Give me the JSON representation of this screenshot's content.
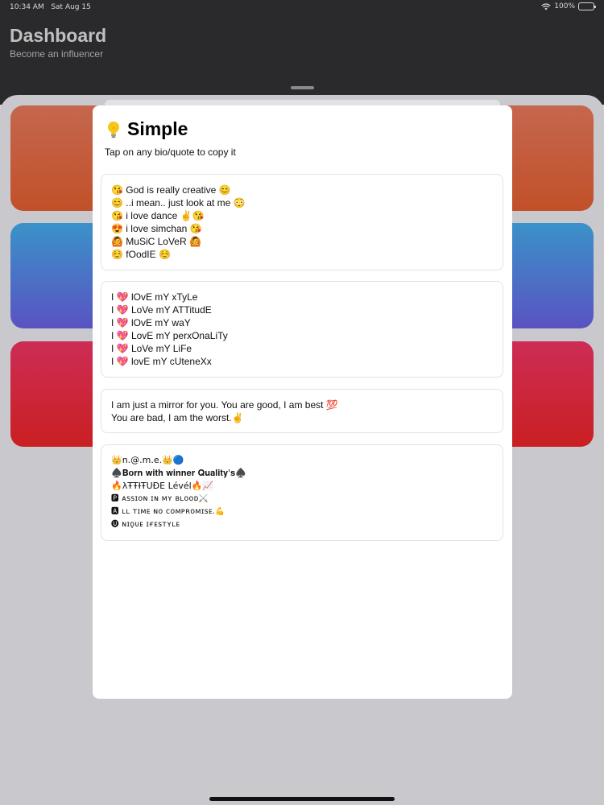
{
  "status": {
    "time": "10:34 AM",
    "date": "Sat Aug 15",
    "battery": "100%"
  },
  "dashboard": {
    "title": "Dashboard",
    "subtitle": "Become an influencer"
  },
  "modal": {
    "title": "Simple",
    "hint": "Tap on any bio/quote to copy it",
    "bios": [
      {
        "lines": [
          "😘 God is really creative 😊",
          "😊 ..i mean.. just look at me 😳",
          "😘 i love dance ✌️😘",
          "😍 i love simchan 😘",
          "🙆 MuSiC LoVeR 🙆",
          "☺️ fOodIE ☺️"
        ]
      },
      {
        "lines": [
          "I 💖 lOvE mY xTyLe",
          "I 💖 LoVe mY ATTitudE",
          "I 💖 lOvE mY waY",
          "I 💖 LovE mY perxOnaLiTy",
          "I 💖 LoVe mY LiFe",
          "I 💖 lovE mY cUteneXx"
        ]
      },
      {
        "lines": [
          "I am just a mirror for you. You are good, I am best 💯",
          "You are bad, I am the worst.✌️"
        ]
      },
      {
        "lines": [
          "👑n.@.m.e.👑🔵",
          "♠️𝐁𝐨𝐫𝐧 𝐰𝐢𝐭𝐡 𝐰𝐢𝐧𝐧𝐞𝐫 𝐐𝐮𝐚𝐥𝐢𝐭𝐲'𝐬♠️",
          "🔥λŦŦƗŦUĐE Lévél🔥📈",
          "🅿 ᴀssɪᴏɴ ɪɴ ᴍʏ ʙʟᴏᴏᴅ⚔️",
          "🅰 ʟʟ ᴛɪᴍᴇ ɴᴏ ᴄᴏᴍᴘʀᴏᴍɪsᴇ.💪",
          "🅤 ɴɪǫᴜᴇ ɪғᴇsᴛʏʟᴇ"
        ]
      }
    ]
  },
  "colors": {
    "card1": "#c25a38",
    "card2": "#4a72c5",
    "card3": "#cb2640",
    "top_bar": "#2a2a2c"
  }
}
